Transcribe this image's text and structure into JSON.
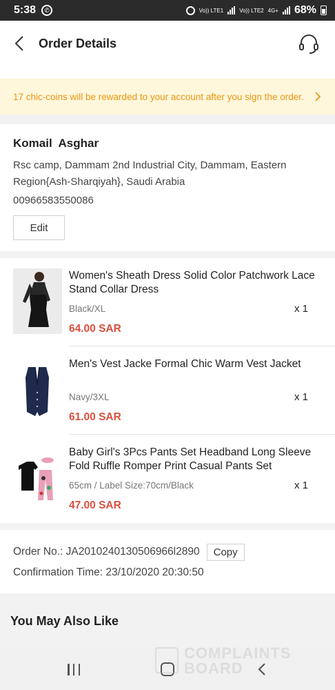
{
  "status_bar": {
    "time": "5:38",
    "sim1": "Vo)) LTE1",
    "sim2": "Vo)) LTE2",
    "net": "4G+",
    "battery": "68%"
  },
  "header": {
    "title": "Order Details",
    "back_icon": "chevron-left-icon",
    "support_icon": "headset-icon"
  },
  "banner": {
    "text": "17 chic-coins will be rewarded to your account after you sign the order.",
    "color": "#e8960f",
    "background": "#fff7dc"
  },
  "address": {
    "name": "Komail  Asghar",
    "line": "Rsc camp, Dammam 2nd Industrial City, Dammam, Eastern Region{Ash-Sharqiyah}, Saudi Arabia",
    "phone": "00966583550086",
    "edit_label": "Edit"
  },
  "products": [
    {
      "title": "Women's Sheath Dress Solid Color Patchwork Lace Stand Collar Dress",
      "variant": "Black/XL",
      "qty": "x 1",
      "price": "64.00 SAR"
    },
    {
      "title": "Men's Vest Jacke Formal Chic Warm Vest Jacket",
      "variant": "Navy/3XL",
      "qty": "x 1",
      "price": "61.00 SAR"
    },
    {
      "title": "Baby Girl's 3Pcs Pants Set Headband Long Sleeve Fold Ruffle Romper Print Casual Pants Set",
      "variant": "65cm / Label Size:70cm/Black",
      "qty": "x 1",
      "price": "47.00 SAR"
    }
  ],
  "price_color": "#d9503f",
  "order": {
    "number_label": "Order No.: JA2010240130506966l2890",
    "copy_label": "Copy",
    "confirmation_label": "Confirmation Time: 23/10/2020 20:30:50"
  },
  "recommend": {
    "title": "You May Also Like"
  },
  "watermark": {
    "line1": "COMPLAINTS",
    "line2": "BOARD"
  }
}
